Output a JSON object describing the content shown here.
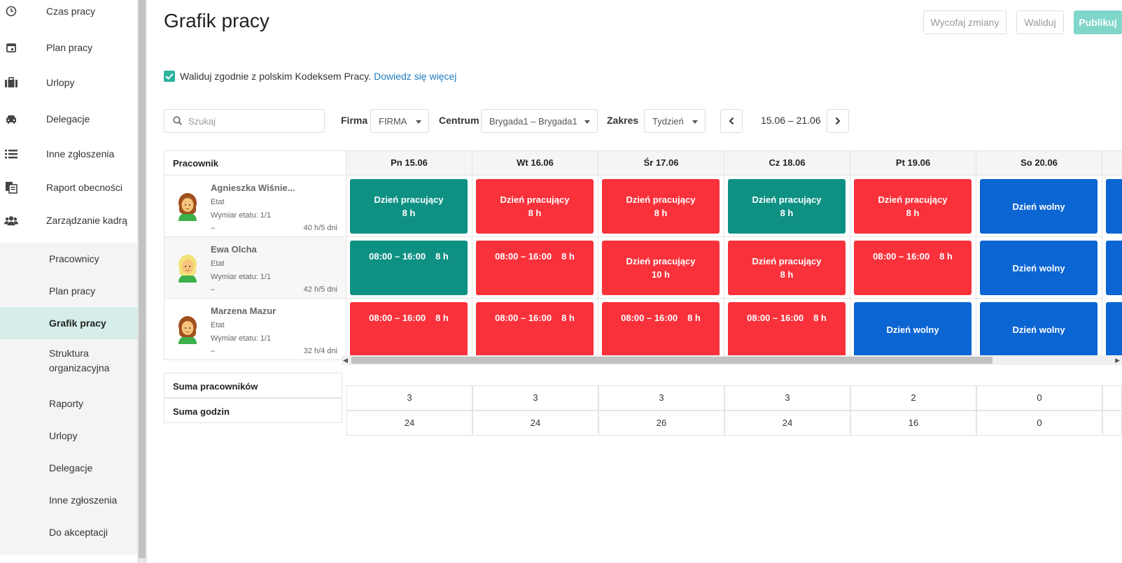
{
  "sidebar": {
    "items": [
      {
        "label": "Czas pracy",
        "icon": "clock-icon"
      },
      {
        "label": "Plan pracy",
        "icon": "calendar-icon"
      },
      {
        "label": "Urlopy",
        "icon": "suitcase-icon"
      },
      {
        "label": "Delegacje",
        "icon": "car-icon"
      },
      {
        "label": "Inne zgłoszenia",
        "icon": "list-icon"
      },
      {
        "label": "Raport obecności",
        "icon": "report-icon"
      },
      {
        "label": "Zarządzanie kadrą",
        "icon": "users-icon"
      }
    ],
    "sub_items": [
      {
        "label": "Pracownicy"
      },
      {
        "label": "Plan pracy"
      },
      {
        "label": "Grafik pracy",
        "active": true
      },
      {
        "label": "Struktura organizacyjna"
      },
      {
        "label": "Raporty"
      },
      {
        "label": "Urlopy"
      },
      {
        "label": "Delegacje"
      },
      {
        "label": "Inne zgłoszenia"
      },
      {
        "label": "Do akceptacji"
      }
    ]
  },
  "header": {
    "title": "Grafik pracy",
    "buttons": {
      "revert": "Wycofaj zmiany",
      "validate": "Waliduj",
      "publish": "Publikuj"
    }
  },
  "validate_option": {
    "checked": true,
    "label": "Waliduj zgodnie z polskim Kodeksem Pracy.",
    "link": "Dowiedz się więcej"
  },
  "filters": {
    "search_placeholder": "Szukaj",
    "firma_label": "Firma",
    "firma_value": "FIRMA",
    "centrum_label": "Centrum",
    "centrum_value": "Brygada1 – Brygada1",
    "zakres_label": "Zakres",
    "zakres_value": "Tydzień",
    "date_range": "15.06 – 21.06"
  },
  "grid": {
    "employee_header": "Pracownik",
    "days": [
      "Pn 15.06",
      "Wt 16.06",
      "Śr 17.06",
      "Cz 18.06",
      "Pt 19.06",
      "So 20.06"
    ],
    "employees": [
      {
        "name": "Agnieszka Wiśnie...",
        "etat": "Etat",
        "wymiar": "Wymiar etatu: 1/1",
        "dash": "–",
        "hours": "40 h/5 dni",
        "hair": "#a0501e",
        "cells": [
          {
            "color": "green",
            "line1": "Dzień pracujący",
            "line2": "8 h"
          },
          {
            "color": "red",
            "line1": "Dzień pracujący",
            "line2": "8 h"
          },
          {
            "color": "red",
            "line1": "Dzień pracujący",
            "line2": "8 h"
          },
          {
            "color": "green",
            "line1": "Dzień pracujący",
            "line2": "8 h"
          },
          {
            "color": "red",
            "line1": "Dzień pracujący",
            "line2": "8 h"
          },
          {
            "color": "blue",
            "line1": "Dzień wolny",
            "line2": ""
          }
        ]
      },
      {
        "name": "Ewa Olcha",
        "etat": "Etat",
        "wymiar": "Wymiar etatu: 1/1",
        "dash": "–",
        "hours": "42 h/5 dni",
        "hair": "#f3e27a",
        "cells": [
          {
            "color": "green",
            "time": "08:00 – 16:00",
            "dur": "8 h"
          },
          {
            "color": "red",
            "time": "08:00 – 16:00",
            "dur": "8 h"
          },
          {
            "color": "red",
            "line1": "Dzień pracujący",
            "line2": "10 h"
          },
          {
            "color": "red",
            "line1": "Dzień pracujący",
            "line2": "8 h"
          },
          {
            "color": "red",
            "time": "08:00 – 16:00",
            "dur": "8 h"
          },
          {
            "color": "blue",
            "line1": "Dzień wolny",
            "line2": ""
          }
        ]
      },
      {
        "name": "Marzena Mazur",
        "etat": "Etat",
        "wymiar": "Wymiar etatu: 1/1",
        "dash": "–",
        "hours": "32 h/4 dni",
        "hair": "#a0501e",
        "cells": [
          {
            "color": "red",
            "time": "08:00 – 16:00",
            "dur": "8 h"
          },
          {
            "color": "red",
            "time": "08:00 – 16:00",
            "dur": "8 h"
          },
          {
            "color": "red",
            "time": "08:00 – 16:00",
            "dur": "8 h"
          },
          {
            "color": "red",
            "time": "08:00 – 16:00",
            "dur": "8 h"
          },
          {
            "color": "blue",
            "line1": "Dzień wolny",
            "line2": ""
          },
          {
            "color": "blue",
            "line1": "Dzień wolny",
            "line2": ""
          }
        ]
      }
    ]
  },
  "summary": {
    "employees_label": "Suma pracowników",
    "hours_label": "Suma godzin",
    "employees_counts": [
      "3",
      "3",
      "3",
      "3",
      "2",
      "0"
    ],
    "hours_totals": [
      "24",
      "24",
      "26",
      "24",
      "16",
      "0"
    ]
  },
  "colors": {
    "green": "#0e9183",
    "red": "#f9313b",
    "blue": "#0b65d3",
    "accent": "#2bb3a0"
  }
}
